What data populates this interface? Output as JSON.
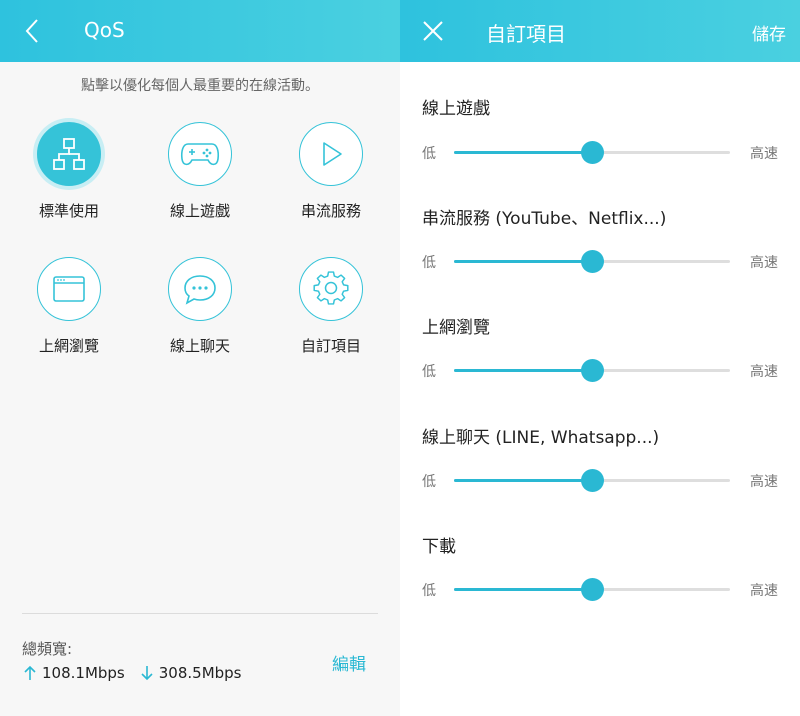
{
  "left": {
    "header": {
      "title": "QoS"
    },
    "hint": "點擊以優化每個人最重要的在線活動。",
    "modes": [
      {
        "label": "標準使用",
        "icon": "network-icon",
        "active": true
      },
      {
        "label": "線上遊戲",
        "icon": "gamepad-icon",
        "active": false
      },
      {
        "label": "串流服務",
        "icon": "play-icon",
        "active": false
      },
      {
        "label": "上網瀏覽",
        "icon": "browser-icon",
        "active": false
      },
      {
        "label": "線上聊天",
        "icon": "chat-icon",
        "active": false
      },
      {
        "label": "自訂項目",
        "icon": "gear-icon",
        "active": false
      }
    ],
    "bandwidth": {
      "label": "總頻寬:",
      "upload": "108.1Mbps",
      "download": "308.5Mbps",
      "edit_label": "編輯"
    }
  },
  "right": {
    "header": {
      "title": "自訂項目",
      "save_label": "儲存"
    },
    "sliders": [
      {
        "title": "線上遊戲",
        "low": "低",
        "high": "高速",
        "value": 0.5
      },
      {
        "title": "串流服務 (YouTube、Netflix...)",
        "low": "低",
        "high": "高速",
        "value": 0.5
      },
      {
        "title": "上網瀏覽",
        "low": "低",
        "high": "高速",
        "value": 0.5
      },
      {
        "title": "線上聊天 (LINE, Whatsapp...)",
        "low": "低",
        "high": "高速",
        "value": 0.5
      },
      {
        "title": "下載",
        "low": "低",
        "high": "高速",
        "value": 0.5
      }
    ]
  },
  "colors": {
    "accent": "#2ab8d3",
    "header_start": "#2ec2de",
    "header_end": "#4ad0e0",
    "track": "#dedede"
  }
}
